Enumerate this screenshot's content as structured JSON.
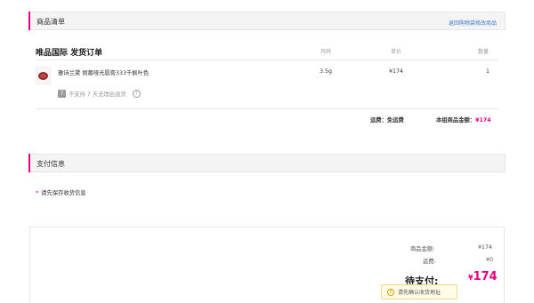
{
  "goods_section": {
    "title": "商品清单",
    "back_link": "返回购物袋修改商品"
  },
  "order": {
    "title": "唯品国际 发货订单",
    "columns": {
      "spec": "尺码",
      "price": "单价",
      "qty": "数量"
    },
    "items": [
      {
        "name": "雅诗兰黛 倾慕哑光唇膏333千枫叶色",
        "spec": "3.5g",
        "price": "¥174",
        "qty": "1",
        "notice_badge": "7",
        "notice_text": "不支持 7 天无理由退货",
        "notice_icon": "question-circle-icon"
      }
    ],
    "shipping_label": "运费：",
    "shipping_value": "免运费",
    "subtotal_label": "本组商品金额：",
    "subtotal_value": "¥174"
  },
  "payment_section": {
    "title": "支付信息",
    "address_note": "请先保存收货信息"
  },
  "totals": {
    "goods_amount_label": "商品金额:",
    "goods_amount_value": "¥174",
    "shipping_label": "运费:",
    "shipping_value": "¥0",
    "due_label": "待支付:",
    "due_currency": "¥",
    "due_value": "174"
  },
  "toast": {
    "icon": "warning-icon",
    "text": "请先确认收货地址"
  },
  "colors": {
    "accent": "#e4007f",
    "link": "#3d7bc6"
  }
}
